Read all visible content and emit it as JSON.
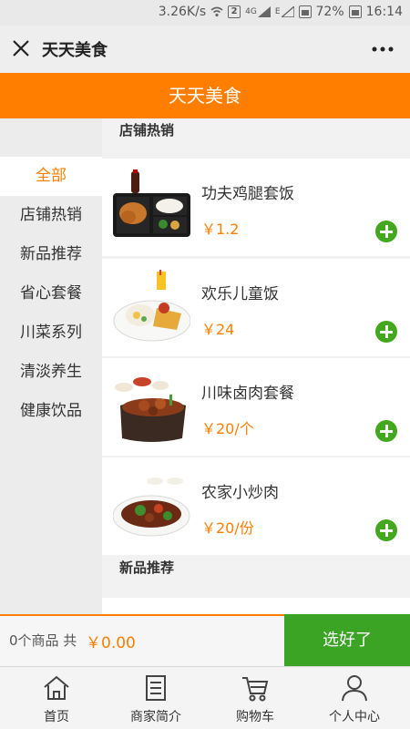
{
  "status_bar": {
    "speed": "3.26K/s",
    "sim_badge": "2",
    "network": "4G",
    "edge": "E",
    "battery": "72%",
    "time": "16:14"
  },
  "titlebar": {
    "title": "天天美食"
  },
  "header": {
    "title": "天天美食"
  },
  "sidebar": {
    "categories": [
      {
        "label": "全部",
        "active": true
      },
      {
        "label": "店铺热销"
      },
      {
        "label": "新品推荐"
      },
      {
        "label": "省心套餐"
      },
      {
        "label": "川菜系列"
      },
      {
        "label": "清淡养生"
      },
      {
        "label": "健康饮品"
      }
    ]
  },
  "main": {
    "sections": [
      {
        "title": "店铺热销",
        "items": [
          {
            "name": "功夫鸡腿套饭",
            "price": "￥1.2"
          },
          {
            "name": "欢乐儿童饭",
            "price": "￥24"
          },
          {
            "name": "川味卤肉套餐",
            "price": "￥20/个"
          },
          {
            "name": "农家小炒肉",
            "price": "￥20/份"
          }
        ]
      },
      {
        "title": "新品推荐"
      }
    ]
  },
  "cart": {
    "count_text": "0个商品 共",
    "total": "￥0.00",
    "done_label": "选好了"
  },
  "nav": {
    "tabs": [
      {
        "label": "首页",
        "icon": "home-icon"
      },
      {
        "label": "商家简介",
        "icon": "document-icon"
      },
      {
        "label": "购物车",
        "icon": "cart-icon"
      },
      {
        "label": "个人中心",
        "icon": "user-icon"
      }
    ]
  },
  "colors": {
    "accent": "#ff7e00",
    "green": "#3ba424"
  }
}
